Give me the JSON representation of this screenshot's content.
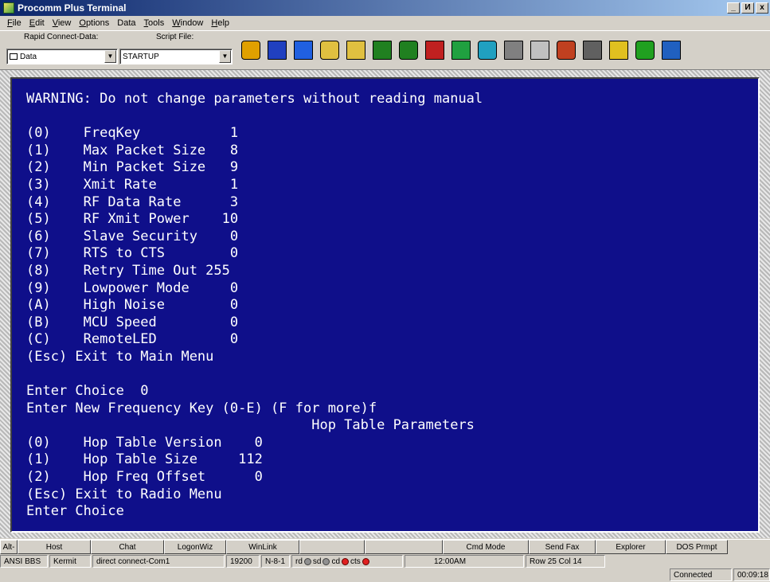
{
  "window": {
    "title": "Procomm Plus Terminal",
    "buttons": [
      "_",
      "И",
      "x"
    ]
  },
  "menu": [
    {
      "label": "File",
      "ul": "F",
      "rest": "ile"
    },
    {
      "label": "Edit",
      "ul": "E",
      "rest": "dit"
    },
    {
      "label": "View",
      "ul": "V",
      "rest": "iew"
    },
    {
      "label": "Options",
      "ul": "O",
      "rest": "ptions"
    },
    {
      "label": "Data",
      "ul": "",
      "rest": "Data"
    },
    {
      "label": "Tools",
      "ul": "T",
      "rest": "ools"
    },
    {
      "label": "Window",
      "ul": "W",
      "rest": "indow"
    },
    {
      "label": "Help",
      "ul": "H",
      "rest": "elp"
    }
  ],
  "toolbar": {
    "rapid_connect_label": "Rapid Connect-Data:",
    "rapid_connect_value": "Data",
    "script_file_label": "Script File:",
    "script_file_value": "STARTUP"
  },
  "toolbar_icons": [
    {
      "name": "runner-icon",
      "color": "#e0a000"
    },
    {
      "name": "book-icon",
      "color": "#2040c0"
    },
    {
      "name": "mode-icon",
      "color": "#2060e0"
    },
    {
      "name": "send-folder-icon",
      "color": "#e0c040"
    },
    {
      "name": "receive-folder-icon",
      "color": "#e0c040"
    },
    {
      "name": "capture-icon",
      "color": "#208020"
    },
    {
      "name": "screen-icon",
      "color": "#208020"
    },
    {
      "name": "phone-icon",
      "color": "#c02020"
    },
    {
      "name": "monitor-icon",
      "color": "#20a040"
    },
    {
      "name": "link-icon",
      "color": "#20a0c0"
    },
    {
      "name": "printer-icon",
      "color": "#808080"
    },
    {
      "name": "filter-icon",
      "color": "#c0c0c0"
    },
    {
      "name": "pen-icon",
      "color": "#c04020"
    },
    {
      "name": "keyboard-icon",
      "color": "#606060"
    },
    {
      "name": "pencil-icon",
      "color": "#e0c020"
    },
    {
      "name": "meter-icon",
      "color": "#20a020"
    },
    {
      "name": "help-icon",
      "color": "#2060c0"
    }
  ],
  "terminal": {
    "lines": [
      "WARNING: Do not change parameters without reading manual",
      "",
      "(0)    FreqKey           1",
      "(1)    Max Packet Size   8",
      "(2)    Min Packet Size   9",
      "(3)    Xmit Rate         1",
      "(4)    RF Data Rate      3",
      "(5)    RF Xmit Power    10",
      "(6)    Slave Security    0",
      "(7)    RTS to CTS        0",
      "(8)    Retry Time Out 255",
      "(9)    Lowpower Mode     0",
      "(A)    High Noise        0",
      "(B)    MCU Speed         0",
      "(C)    RemoteLED         0",
      "(Esc) Exit to Main Menu",
      "",
      "Enter Choice  0",
      "Enter New Frequency Key (0-E) (F for more)f",
      "                                   Hop Table Parameters",
      "(0)    Hop Table Version    0",
      "(1)    Hop Table Size     112",
      "(2)    Hop Freq Offset      0",
      "(Esc) Exit to Radio Menu",
      "Enter Choice"
    ]
  },
  "button_bar": [
    {
      "label": "Alt-"
    },
    {
      "label": "Host"
    },
    {
      "label": "Chat"
    },
    {
      "label": "LogonWiz"
    },
    {
      "label": "WinLink"
    },
    {
      "label": ""
    },
    {
      "label": ""
    },
    {
      "label": "Cmd Mode"
    },
    {
      "label": "Send Fax"
    },
    {
      "label": "Explorer"
    },
    {
      "label": "DOS Prmpt"
    }
  ],
  "status": {
    "emulation": "ANSI BBS",
    "protocol": "Kermit",
    "connection": "direct connect-Com1",
    "baud": "19200",
    "parity": "N-8-1",
    "rd": "rd",
    "sd": "sd",
    "cd": "cd",
    "cts": "cts",
    "time": "12:00AM",
    "position": "Row 25  Col 14",
    "state": "Connected",
    "elapsed": "00:09:18"
  }
}
